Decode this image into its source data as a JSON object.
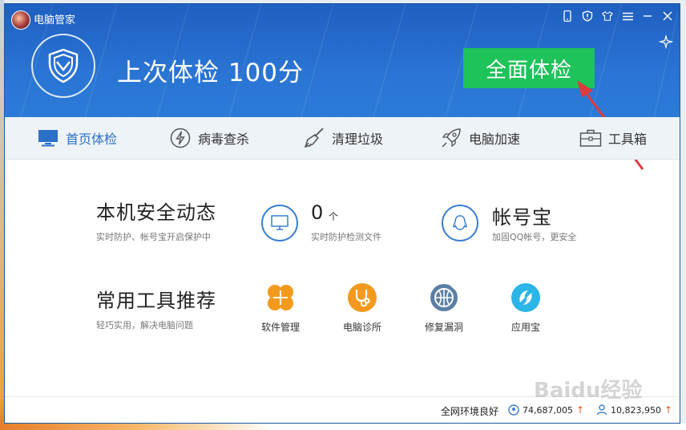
{
  "app": {
    "title": "电脑管家"
  },
  "header": {
    "score_text": "上次体检 100分",
    "check_button": "全面体检"
  },
  "nav": {
    "items": [
      {
        "label": "首页体检",
        "icon": "monitor-icon"
      },
      {
        "label": "病毒查杀",
        "icon": "lightning-icon"
      },
      {
        "label": "清理垃圾",
        "icon": "broom-icon"
      },
      {
        "label": "电脑加速",
        "icon": "rocket-icon"
      },
      {
        "label": "工具箱",
        "icon": "toolbox-icon"
      }
    ]
  },
  "security": {
    "title": "本机安全动态",
    "subtitle": "实时防护、帐号宝开启保护中",
    "realtime": {
      "count": "0",
      "unit": "个",
      "label": "实时防护检测文件"
    },
    "account": {
      "title": "帐号宝",
      "label": "加固QQ帐号，更安全"
    }
  },
  "tools": {
    "title": "常用工具推荐",
    "subtitle": "轻巧实用，解决电脑问题",
    "items": [
      {
        "label": "软件管理",
        "icon": "clover-icon",
        "color": "#f39a1e"
      },
      {
        "label": "电脑诊所",
        "icon": "stethoscope-icon",
        "color": "#f39a1e"
      },
      {
        "label": "修复漏洞",
        "icon": "patch-globe-icon",
        "color": "#5b7fa6"
      },
      {
        "label": "应用宝",
        "icon": "appstore-icon",
        "color": "#2bb5e8"
      }
    ]
  },
  "status": {
    "network": "全网环境良好",
    "stat1": "74,687,005",
    "stat2": "10,823,950"
  },
  "watermark": "Baidu经验",
  "colors": {
    "header": "#2a74d4",
    "accent": "#1ec35a",
    "arrow": "#e03a3a"
  }
}
